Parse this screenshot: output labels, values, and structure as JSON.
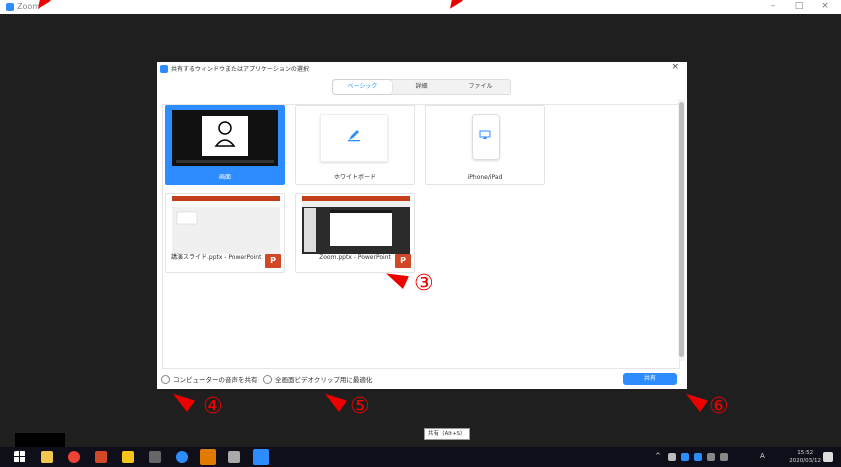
{
  "app": {
    "title": "Zoom"
  },
  "window_controls": {
    "minimize": "–",
    "maximize": "□",
    "close": "×"
  },
  "dialog": {
    "title": "共有するウィンドウまたはアプリケーションの選択",
    "close": "×",
    "tabs": [
      {
        "label": "ベーシック",
        "active": true
      },
      {
        "label": "詳細",
        "active": false
      },
      {
        "label": "ファイル",
        "active": false
      }
    ],
    "tiles": [
      {
        "label": "画面",
        "selected": true
      },
      {
        "label": "ホワイトボード",
        "selected": false
      },
      {
        "label": "iPhone/iPad",
        "selected": false
      },
      {
        "label": "講演スライド.pptx - PowerPoint",
        "selected": false
      },
      {
        "label": "Zoom.pptx - PowerPoint",
        "selected": false
      }
    ],
    "ppt_badge": "P",
    "checkbox_computer_audio": "コンピューターの音声を共有",
    "checkbox_video_clip": "全画面ビデオクリップ用に最適化",
    "share_button": "共有"
  },
  "annotations": {
    "m3": "③",
    "m4": "④",
    "m5": "⑤",
    "m6": "⑥"
  },
  "tooltip": "共有（Alt+S）",
  "taskbar": {
    "tray_text": "^",
    "ime": "A",
    "time": "15:52",
    "date": "2020/03/12"
  },
  "colors": {
    "accent": "#2d8cff",
    "annotation": "#e00000",
    "powerpoint": "#d24726"
  }
}
